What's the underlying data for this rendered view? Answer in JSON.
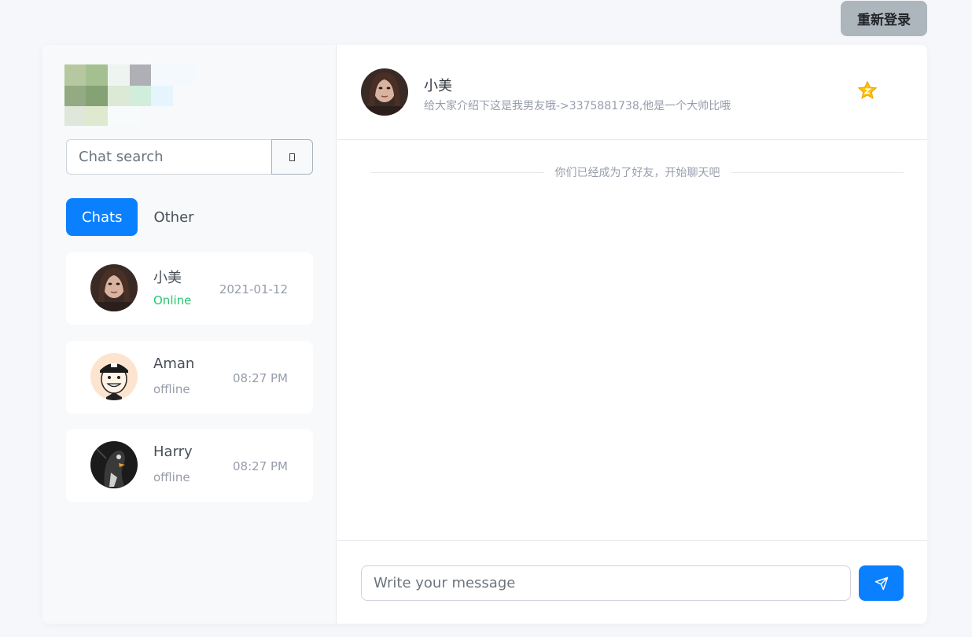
{
  "top": {
    "relogin_label": "重新登录"
  },
  "sidebar": {
    "search": {
      "placeholder": "Chat search"
    },
    "tabs": [
      {
        "label": "Chats",
        "active": true
      },
      {
        "label": "Other",
        "active": false
      }
    ],
    "chats": [
      {
        "name": "小美",
        "status": "Online",
        "time": "2021-01-12",
        "avatar": "avatar-xiaomei"
      },
      {
        "name": "Aman",
        "status": "offline",
        "time": "08:27 PM",
        "avatar": "avatar-aman"
      },
      {
        "name": "Harry",
        "status": "offline",
        "time": "08:27 PM",
        "avatar": "avatar-harry"
      }
    ]
  },
  "conversation": {
    "header": {
      "name": "小美",
      "description": "给大家介绍下这是我男友哦->3375881738,他是一个大帅比哦",
      "favorite_icon": "star-icon"
    },
    "system_message": "你们已经成为了好友，开始聊天吧",
    "composer": {
      "placeholder": "Write your message",
      "send_icon": "send-icon"
    }
  },
  "colors": {
    "accent": "#0a80ff",
    "online": "#28c76f",
    "muted": "#969dab",
    "star": "#ffc107"
  }
}
